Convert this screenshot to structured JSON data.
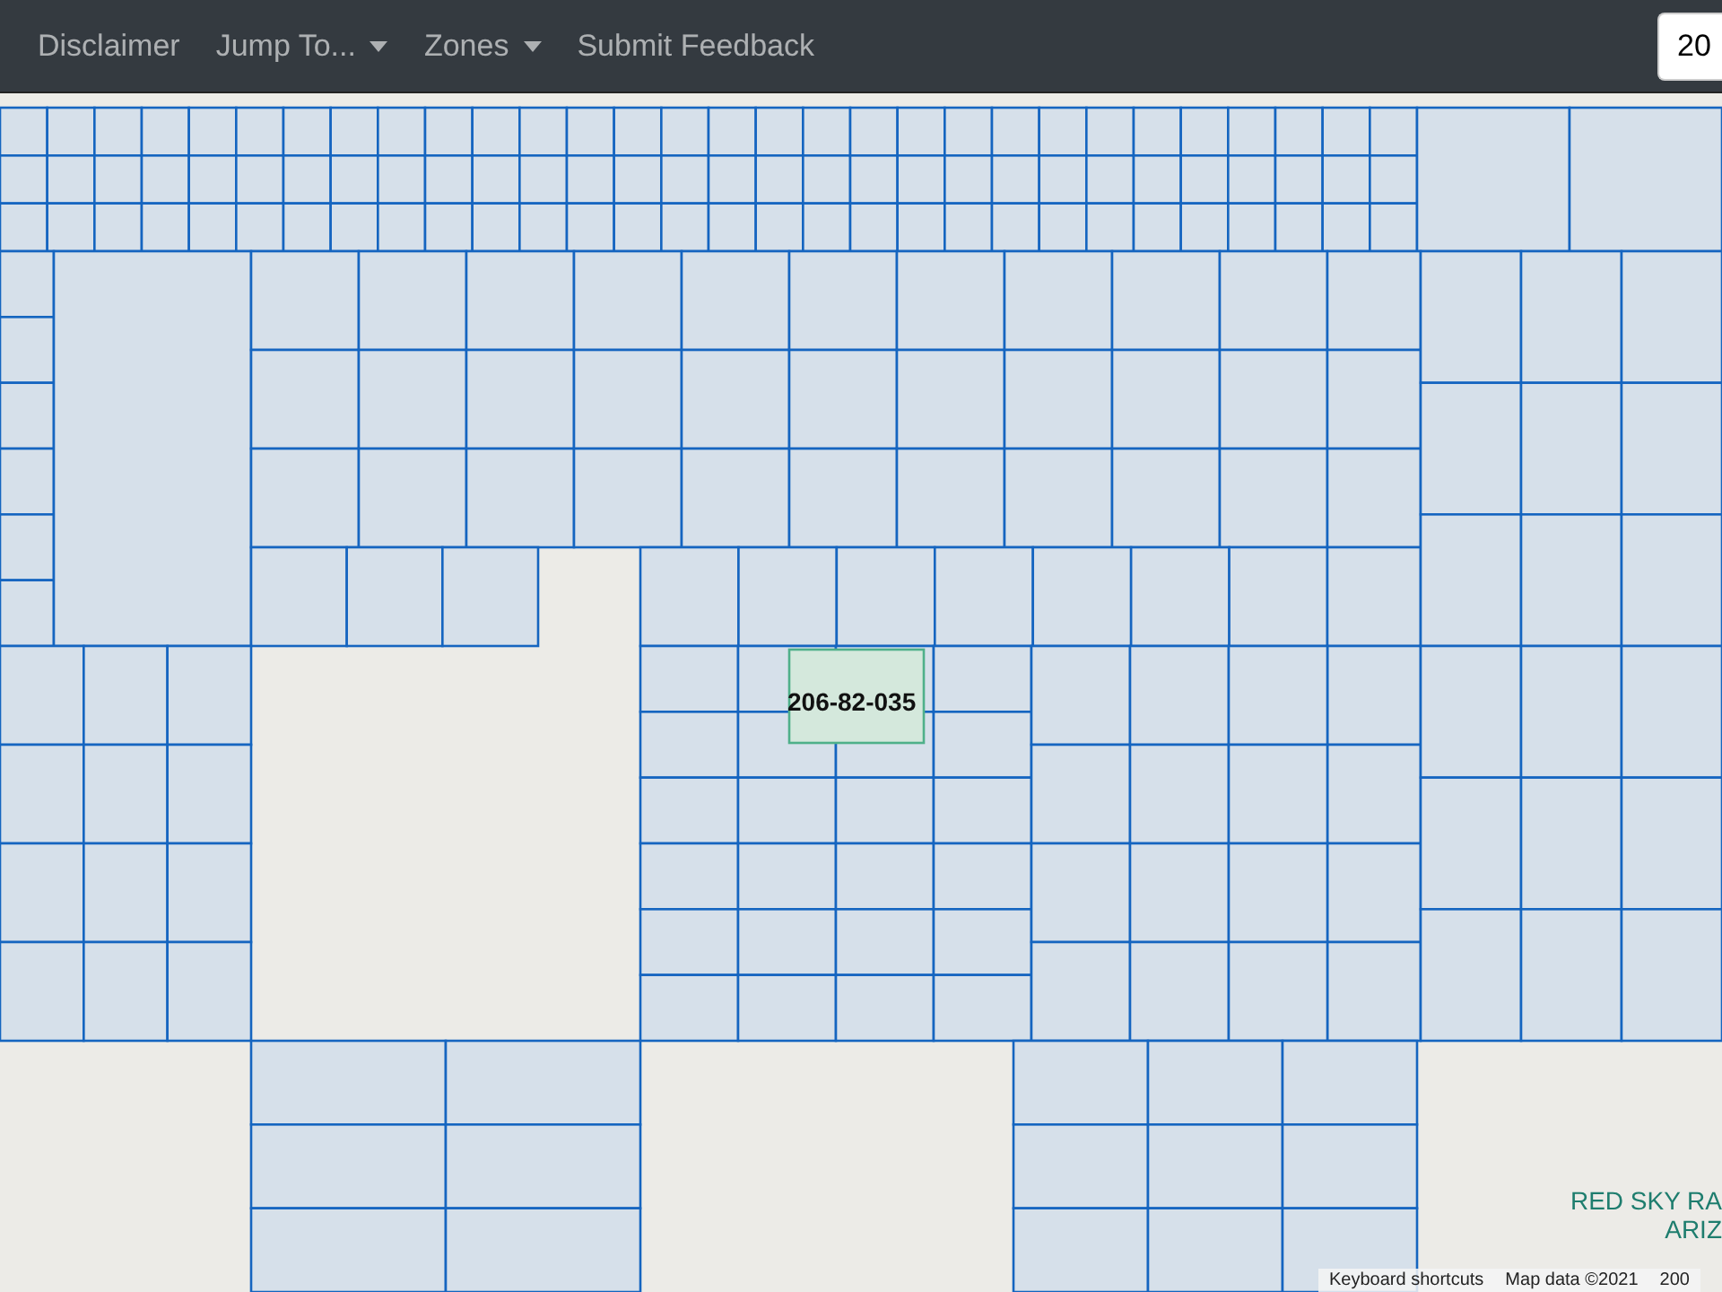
{
  "navbar": {
    "items": [
      {
        "label": "Disclaimer",
        "kind": "link"
      },
      {
        "label": "Jump To...",
        "kind": "dropdown"
      },
      {
        "label": "Zones",
        "kind": "dropdown"
      },
      {
        "label": "Submit Feedback",
        "kind": "link"
      }
    ],
    "search": {
      "value": "20"
    }
  },
  "map": {
    "selected_parcel": {
      "label": "206-82-035"
    },
    "place_label": [
      "RED SKY RA",
      "ARIZ"
    ],
    "attribution": [
      "Keyboard shortcuts",
      "Map data ©2021",
      "200"
    ]
  }
}
